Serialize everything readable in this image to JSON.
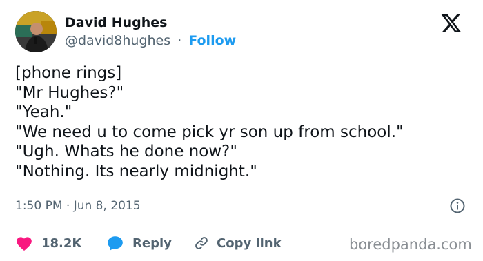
{
  "author": {
    "name": "David Hughes",
    "handle": "@david8hughes",
    "separator": "·",
    "follow_label": "Follow"
  },
  "tweet": {
    "lines": [
      "[phone rings]",
      "\"Mr Hughes?\"",
      "\"Yeah.\"",
      "\"We need u to come pick yr son up from school.\"",
      "\"Ugh. Whats he done now?\"",
      "\"Nothing. Its nearly midnight.\""
    ],
    "timestamp": "1:50 PM · Jun 8, 2015"
  },
  "actions": {
    "likes": "18.2K",
    "reply_label": "Reply",
    "copy_label": "Copy link"
  },
  "watermark": "boredpanda.com",
  "colors": {
    "text": "#0f1419",
    "secondary": "#536471",
    "accent": "#1d9bf0",
    "like": "#f91880",
    "divider": "#cfd9de"
  },
  "icons": {
    "brand": "x-logo-icon",
    "info": "info-icon",
    "like": "heart-icon",
    "reply": "speech-bubble-icon",
    "copy": "link-icon"
  }
}
